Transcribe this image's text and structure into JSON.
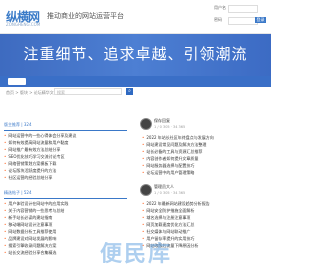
{
  "header": {
    "logo": "纵横网",
    "logo_sub": "ZONGHENG.COM",
    "slogan": "推动商业的网站运营平台",
    "user_label": "用户名",
    "pass_label": "密码",
    "login": "登录"
  },
  "banner": {
    "text": "注重细节、追求卓越、引领潮流"
  },
  "breadcrumb": "首页 > 版块 > 论坛精华文章 > Tab163",
  "search": {
    "placeholder": "搜索"
  },
  "left": {
    "sec1_title": "版主推荐 | 324",
    "items1": [
      "网站运营中的一些心得体会分享及建议",
      "如何有效提高网站流量和用户黏度",
      "网站推广最有效方法总结分享",
      "SEO优化技巧学习交流讨论专区",
      "网络营销策划方案模板下载",
      "论坛版块活跃度提升的方法",
      "社区运营的经验总结分享"
    ],
    "sec2_title": "精选帖子 | 524",
    "items2": [
      "用户体验设计在网站中的应用实践",
      "关于内容营销的一些思考与总结",
      "新手站长必读的建站指南",
      "移动端网站设计注意事项",
      "网站数据分析工具推荐使用",
      "品牌建设对网站发展的影响",
      "搜索引擎收录问题解决方案",
      "站长交流经验分享合集精选"
    ]
  },
  "right": {
    "user1": "保存回复",
    "meta1": "1 / 0  305 · 34 365",
    "items1": [
      "2022 年站长社区年终盘点与发展方向",
      "网站建设常见问题及解决方法整理",
      "站长必备的工具与资源汇总推荐",
      "内容创作者如何提升文章质量",
      "网站服务器选择与配置技巧",
      "论坛运营中的用户管理策略"
    ],
    "user2": "管理员大人",
    "meta2": "1 / 0  305 · 34 365",
    "items2": [
      "2022 年最新网站建设趋势分析报告",
      "网站安全防护措施全面解析",
      "域名选择与注册注意事项",
      "网页加载速度优化方法汇总",
      "社交媒体与网站联动推广",
      "用户留存率提升的实用技巧",
      "网站改版后流量下降原因分析"
    ]
  },
  "watermark": "便民库"
}
